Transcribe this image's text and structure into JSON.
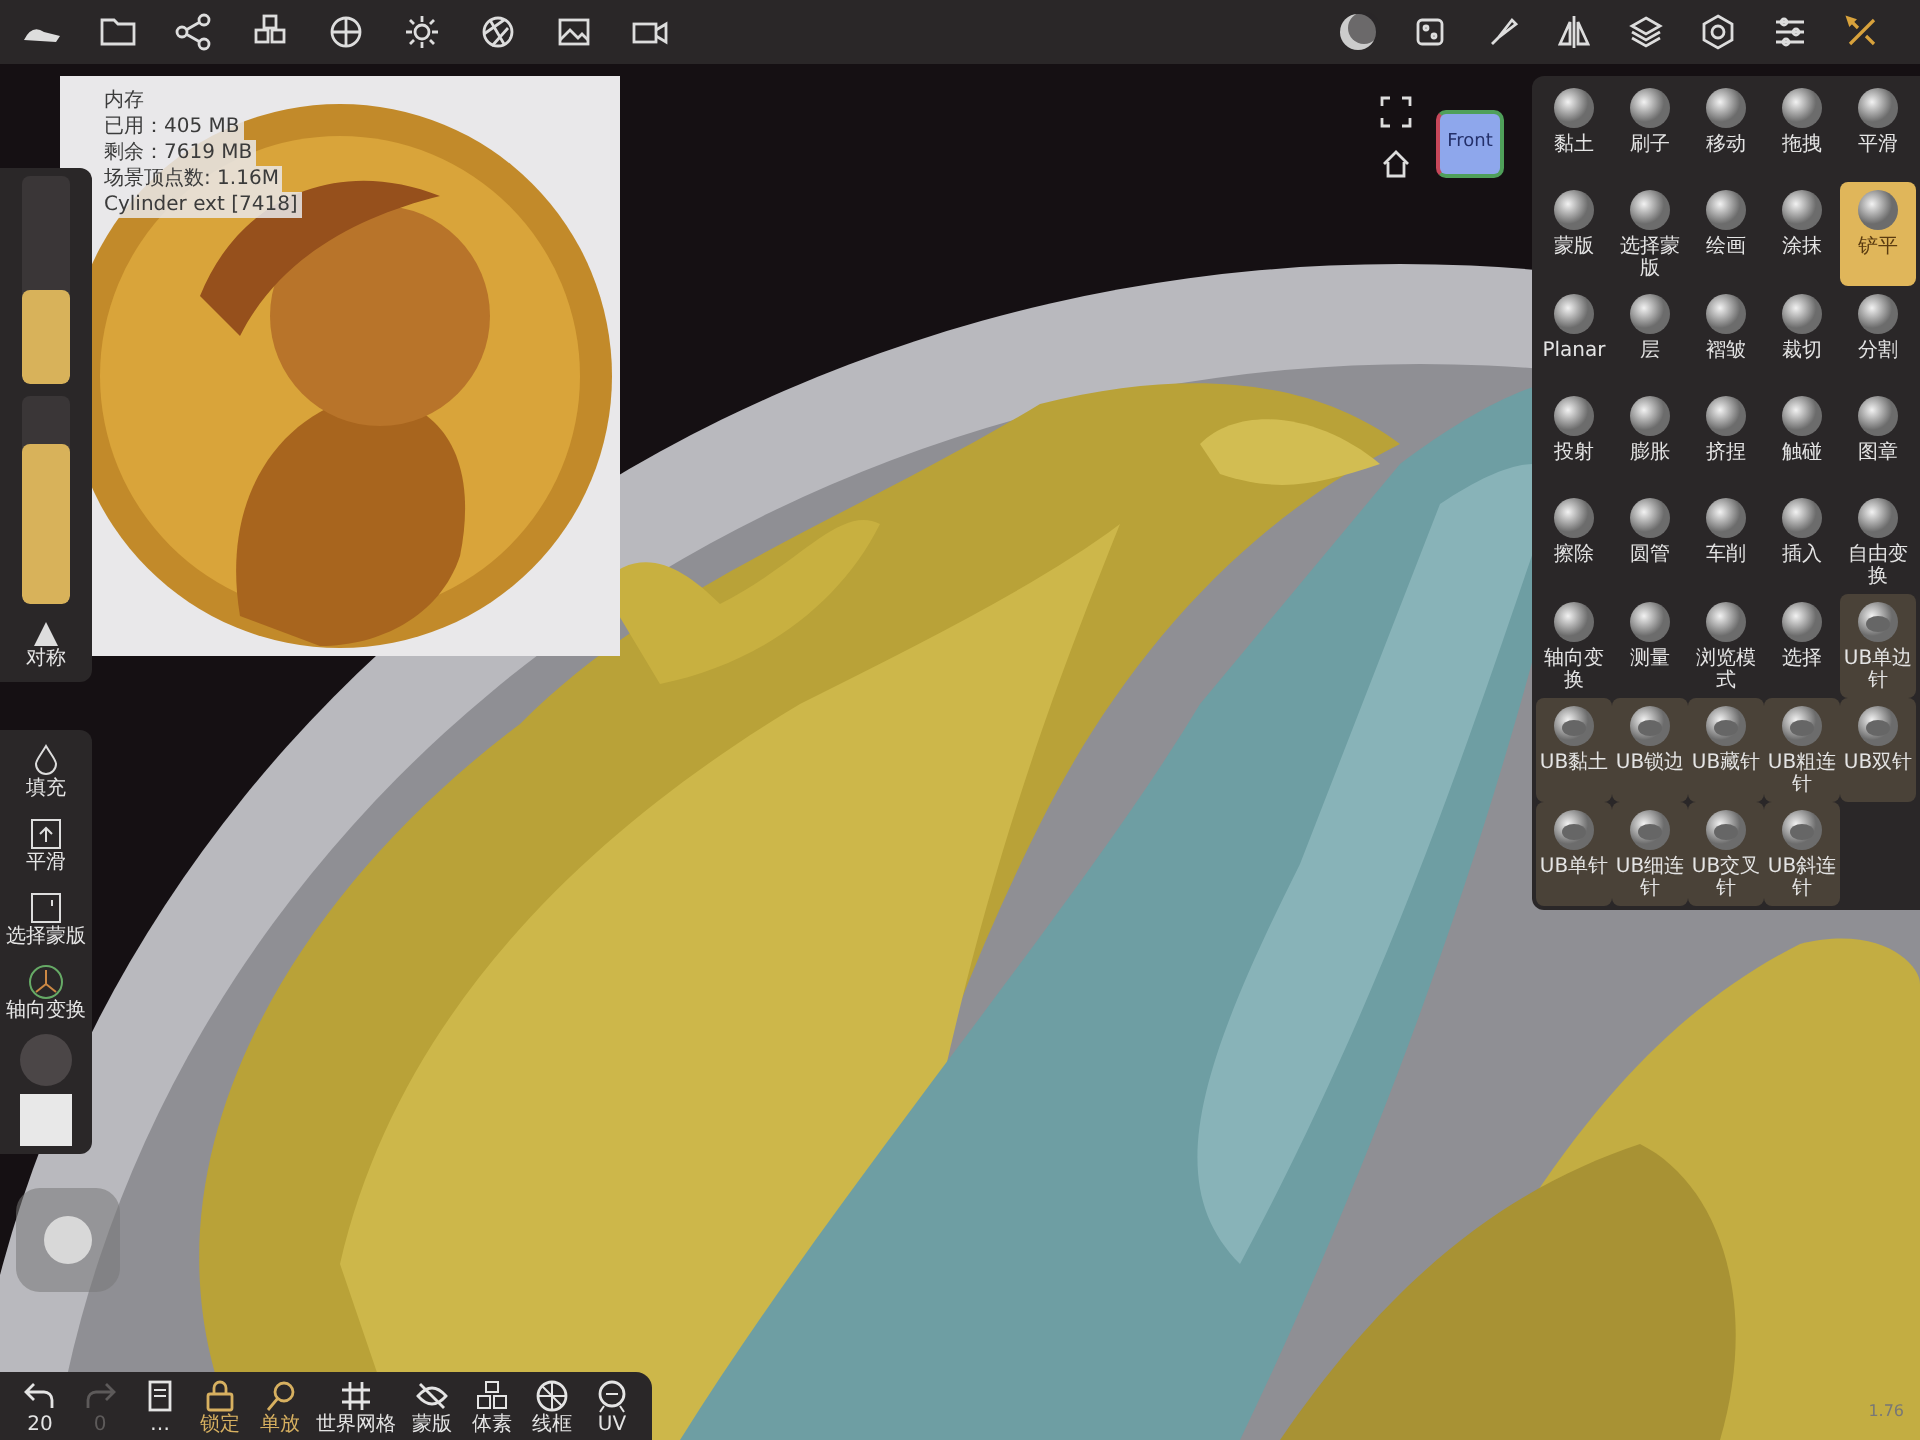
{
  "info_overlay": {
    "lines": [
      "内存",
      "已用：405 MB",
      "剩余：7619 MB",
      "场景顶点数: 1.16M",
      "Cylinder ext [7418]"
    ]
  },
  "left_panel": {
    "sliders": [
      {
        "level": 0.45
      },
      {
        "level": 0.77
      }
    ],
    "symmetry": {
      "label": "对称"
    },
    "tools": [
      {
        "label": "填充"
      },
      {
        "label": "平滑"
      },
      {
        "label": "选择蒙版"
      },
      {
        "label": "轴向变换"
      }
    ]
  },
  "view_cube": {
    "label": "Front"
  },
  "tools_panel": [
    {
      "label": "黏土",
      "selected": false,
      "kind": "builtin"
    },
    {
      "label": "刷子",
      "selected": false,
      "kind": "builtin"
    },
    {
      "label": "移动",
      "selected": false,
      "kind": "builtin"
    },
    {
      "label": "拖拽",
      "selected": false,
      "kind": "builtin"
    },
    {
      "label": "平滑",
      "selected": false,
      "kind": "builtin"
    },
    {
      "label": "蒙版",
      "selected": false,
      "kind": "builtin"
    },
    {
      "label": "选择蒙版",
      "selected": false,
      "kind": "builtin"
    },
    {
      "label": "绘画",
      "selected": false,
      "kind": "builtin"
    },
    {
      "label": "涂抹",
      "selected": false,
      "kind": "builtin"
    },
    {
      "label": "铲平",
      "selected": true,
      "kind": "builtin"
    },
    {
      "label": "Planar",
      "selected": false,
      "kind": "builtin"
    },
    {
      "label": "层",
      "selected": false,
      "kind": "builtin"
    },
    {
      "label": "褶皱",
      "selected": false,
      "kind": "builtin"
    },
    {
      "label": "裁切",
      "selected": false,
      "kind": "builtin"
    },
    {
      "label": "分割",
      "selected": false,
      "kind": "builtin"
    },
    {
      "label": "投射",
      "selected": false,
      "kind": "builtin"
    },
    {
      "label": "膨胀",
      "selected": false,
      "kind": "builtin"
    },
    {
      "label": "挤捏",
      "selected": false,
      "kind": "builtin"
    },
    {
      "label": "触碰",
      "selected": false,
      "kind": "builtin"
    },
    {
      "label": "图章",
      "selected": false,
      "kind": "builtin"
    },
    {
      "label": "擦除",
      "selected": false,
      "kind": "builtin"
    },
    {
      "label": "圆管",
      "selected": false,
      "kind": "builtin"
    },
    {
      "label": "车削",
      "selected": false,
      "kind": "builtin"
    },
    {
      "label": "插入",
      "selected": false,
      "kind": "builtin"
    },
    {
      "label": "自由变换",
      "selected": false,
      "kind": "builtin"
    },
    {
      "label": "轴向变换",
      "selected": false,
      "kind": "builtin"
    },
    {
      "label": "测量",
      "selected": false,
      "kind": "builtin"
    },
    {
      "label": "浏览模式",
      "selected": false,
      "kind": "builtin"
    },
    {
      "label": "选择",
      "selected": false,
      "kind": "builtin"
    },
    {
      "label": "UB单边针",
      "selected": false,
      "kind": "custom"
    },
    {
      "label": "UB黏土",
      "selected": false,
      "kind": "custom"
    },
    {
      "label": "UB锁边",
      "selected": false,
      "kind": "custom"
    },
    {
      "label": "UB藏针",
      "selected": false,
      "kind": "custom"
    },
    {
      "label": "UB粗连针",
      "selected": false,
      "kind": "custom"
    },
    {
      "label": "UB双针",
      "selected": false,
      "kind": "custom"
    },
    {
      "label": "UB单针",
      "selected": false,
      "kind": "custom"
    },
    {
      "label": "UB细连针",
      "selected": false,
      "kind": "custom"
    },
    {
      "label": "UB交叉针",
      "selected": false,
      "kind": "custom"
    },
    {
      "label": "UB斜连针",
      "selected": false,
      "kind": "custom"
    }
  ],
  "bottom_bar": [
    {
      "label": "20",
      "kind": "undo",
      "active": false,
      "disabled": false
    },
    {
      "label": "0",
      "kind": "redo",
      "active": false,
      "disabled": true
    },
    {
      "label": "…",
      "kind": "file",
      "active": false,
      "disabled": false
    },
    {
      "label": "锁定",
      "kind": "lock",
      "active": true,
      "disabled": false
    },
    {
      "label": "单放",
      "kind": "search",
      "active": true,
      "disabled": false
    },
    {
      "label": "世界网格",
      "kind": "grid",
      "active": false,
      "disabled": false
    },
    {
      "label": "蒙版",
      "kind": "eye",
      "active": false,
      "disabled": false
    },
    {
      "label": "体素",
      "kind": "voxel",
      "active": false,
      "disabled": false
    },
    {
      "label": "线框",
      "kind": "wire",
      "active": false,
      "disabled": false
    },
    {
      "label": "UV",
      "kind": "uv",
      "active": false,
      "disabled": false
    }
  ],
  "version": "1.76"
}
